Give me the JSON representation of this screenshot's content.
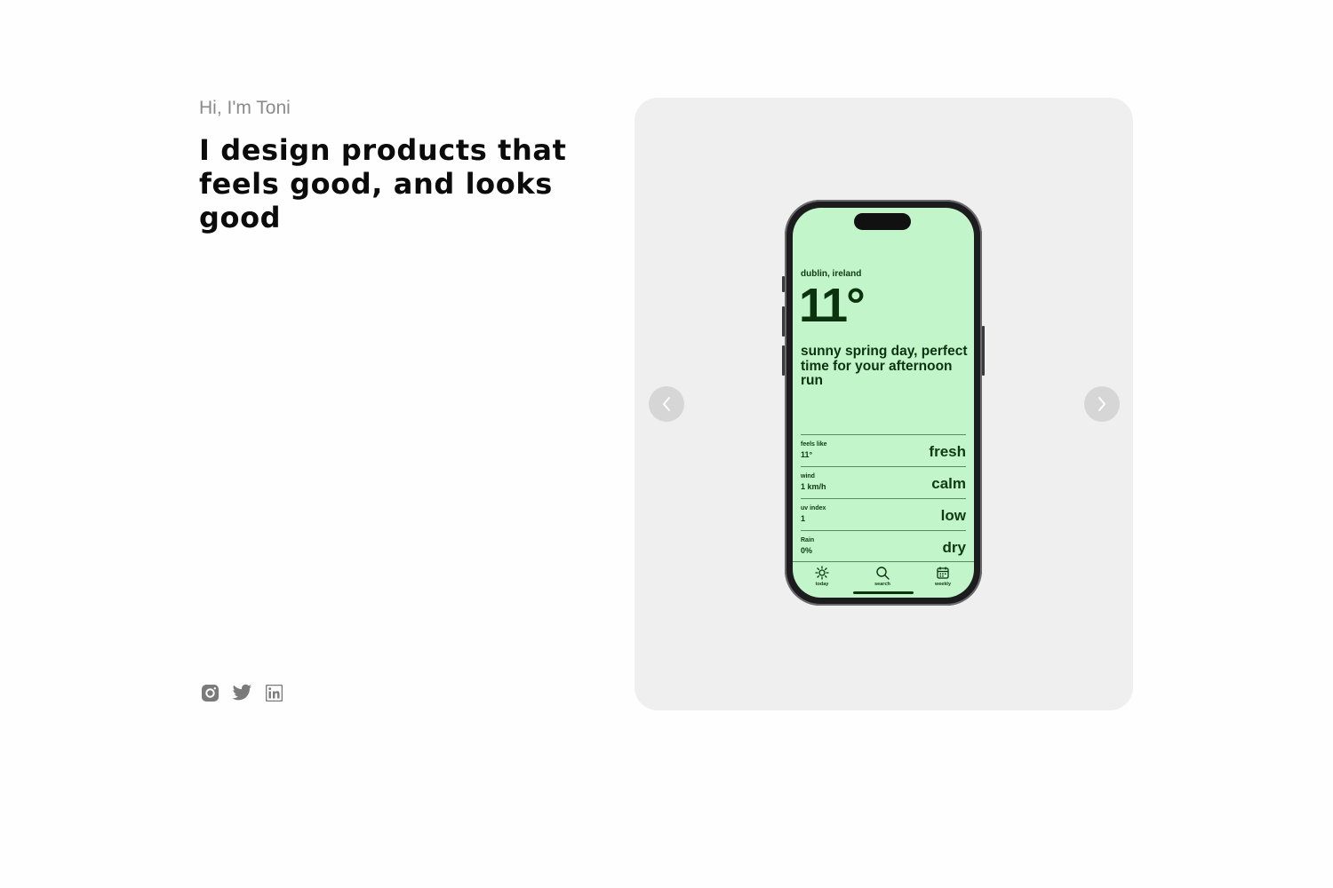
{
  "intro": {
    "greeting": "Hi, I'm Toni",
    "headline": "I design products that feels good, and looks good"
  },
  "socials": [
    {
      "icon": "instagram-icon"
    },
    {
      "icon": "twitter-icon"
    },
    {
      "icon": "linkedin-icon"
    }
  ],
  "carousel": {
    "prev_icon": "chevron-left-icon",
    "next_icon": "chevron-right-icon",
    "screen": {
      "location": "dublin, ireland",
      "temperature": "11°",
      "description": "sunny spring day, perfect time for your afternoon run",
      "rows": [
        {
          "label": "feels like",
          "value": "11°",
          "word": "fresh"
        },
        {
          "label": "wind",
          "value": "1 km/h",
          "word": "calm"
        },
        {
          "label": "uv index",
          "value": "1",
          "word": "low"
        },
        {
          "label": "Rain",
          "value": "0%",
          "word": "dry"
        }
      ],
      "tabs": [
        {
          "label": "today",
          "icon": "sun-icon"
        },
        {
          "label": "search",
          "icon": "search-icon"
        },
        {
          "label": "weekly",
          "icon": "calendar-icon"
        }
      ]
    }
  },
  "colors": {
    "screen_bg": "#c2f5c9",
    "screen_text": "#0b3310",
    "card_bg": "#efefef",
    "greeting": "#8a8a8a"
  }
}
